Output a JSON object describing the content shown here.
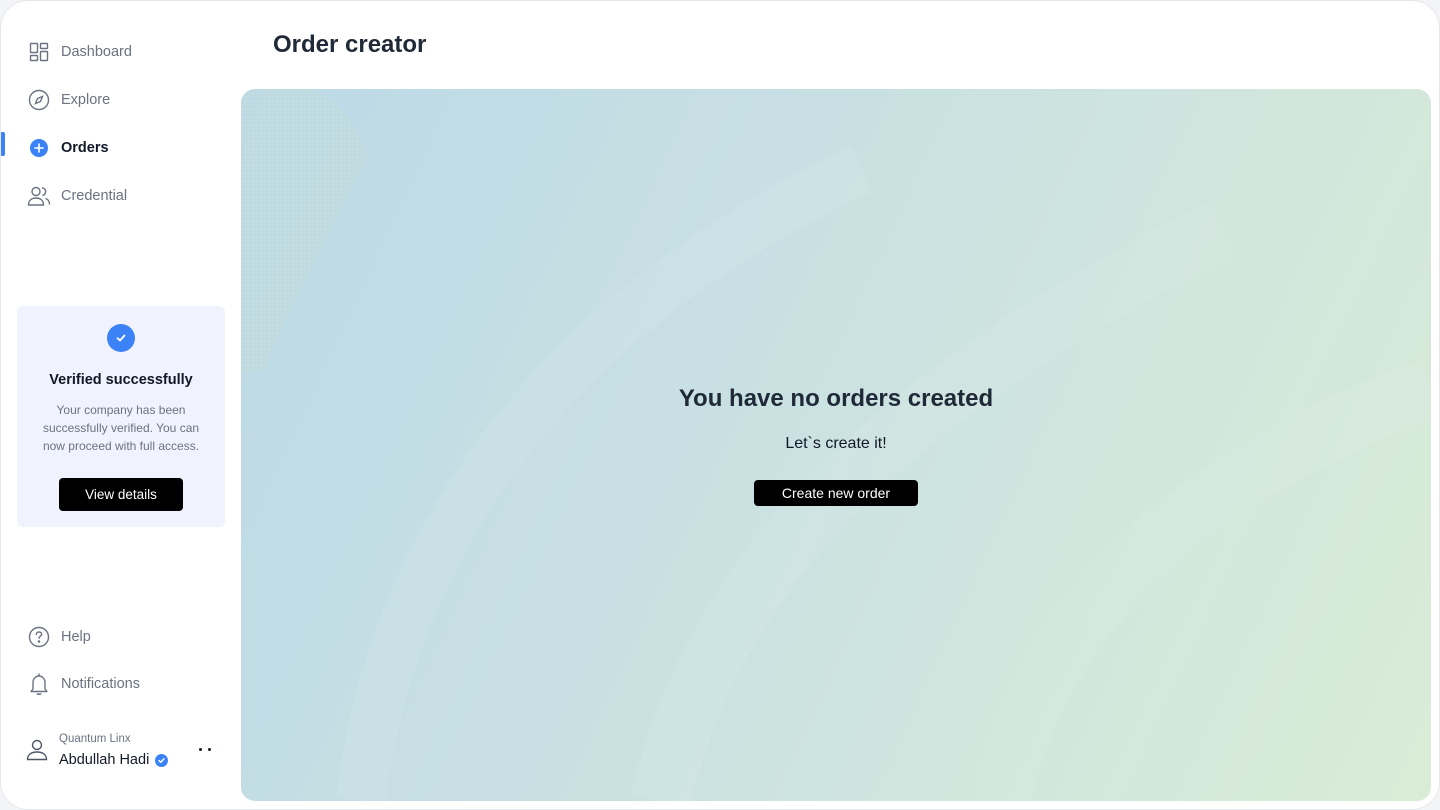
{
  "sidebar": {
    "nav": [
      {
        "label": "Dashboard",
        "icon": "dashboard-icon"
      },
      {
        "label": "Explore",
        "icon": "compass-icon"
      },
      {
        "label": "Orders",
        "icon": "plus-circle-icon",
        "active": true
      },
      {
        "label": "Credential",
        "icon": "users-icon"
      }
    ],
    "verify_card": {
      "title": "Verified successfully",
      "description": "Your company has been successfully verified. You can now proceed with full access.",
      "button_label": "View details"
    },
    "bottom_nav": [
      {
        "label": "Help",
        "icon": "help-icon"
      },
      {
        "label": "Notifications",
        "icon": "bell-icon"
      }
    ],
    "user": {
      "company": "Quantum Linx",
      "name": "Abdullah Hadi"
    }
  },
  "main": {
    "title": "Order creator",
    "empty_state": {
      "title": "You have no orders created",
      "subtitle": "Let`s create it!",
      "button_label": "Create new order"
    }
  },
  "colors": {
    "accent": "#3b82f6",
    "button_bg": "#000000",
    "card_bg": "#f0f3fd"
  }
}
